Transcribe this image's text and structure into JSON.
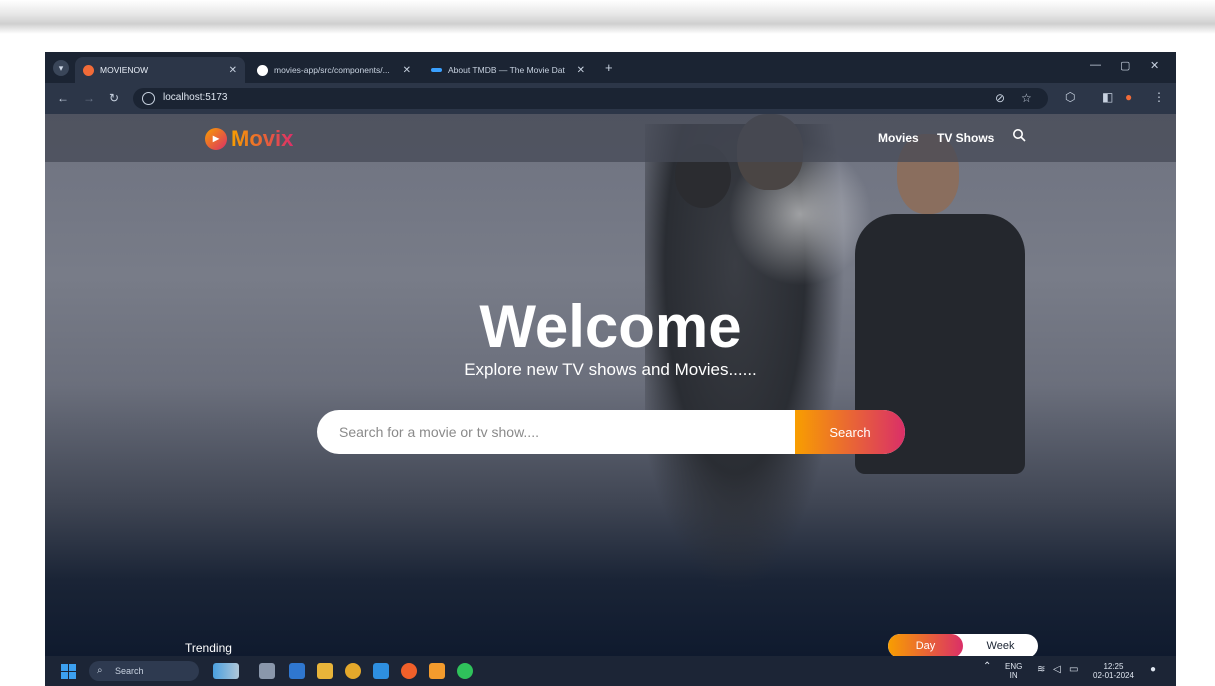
{
  "browser": {
    "tabs": [
      {
        "label": "MOVIENOW",
        "active": true,
        "favicon_color": "#f26b38"
      },
      {
        "label": "movies-app/src/components/...",
        "active": false,
        "favicon_color": "#ffffff"
      },
      {
        "label": "About TMDB — The Movie Dat",
        "active": false,
        "favicon_color": "#3aa0ff"
      }
    ],
    "new_tab": "+",
    "window_controls": {
      "minimize": "—",
      "maximize": "▢",
      "close": "✕"
    },
    "nav": {
      "back": "←",
      "forward": "→",
      "reload": "↻"
    },
    "url": "localhost:5173"
  },
  "site": {
    "logo": "Movix",
    "nav": [
      {
        "label": "Movies"
      },
      {
        "label": "TV Shows"
      }
    ],
    "hero": {
      "title": "Welcome",
      "subtitle": "Explore new TV shows and Movies......"
    },
    "search": {
      "placeholder": "Search for a movie or tv show....",
      "button": "Search"
    },
    "trending": {
      "label": "Trending",
      "switch": [
        "Day",
        "Week"
      ],
      "selected": "Day"
    }
  },
  "taskbar": {
    "search_label": "Search",
    "tray": {
      "lang_top": "ENG",
      "lang_bottom": "IN",
      "time": "12:25",
      "date": "02-01-2024"
    }
  },
  "colors": {
    "accent_start": "#f89e00",
    "accent_end": "#da2f68",
    "browser_chrome": "#2c3648",
    "taskbar": "#1c2536"
  }
}
